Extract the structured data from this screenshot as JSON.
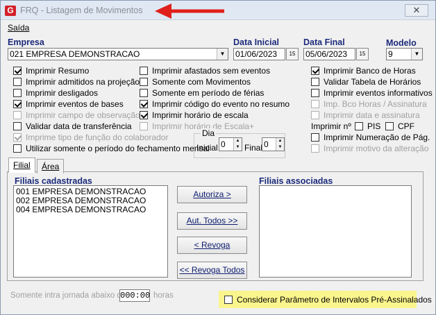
{
  "window": {
    "title": "FRQ - Listagem de Movimentos",
    "close_glyph": "✕",
    "logo_letter": "G"
  },
  "menu": {
    "saida": "Saída"
  },
  "empresa": {
    "label": "Empresa",
    "value": "021 EMPRESA DEMONSTRACAO"
  },
  "data_inicial": {
    "label": "Data Inicial",
    "value": "01/06/2023",
    "button": "15"
  },
  "data_final": {
    "label": "Data Final",
    "value": "05/06/2023",
    "button": "15"
  },
  "modelo": {
    "label": "Modelo",
    "value": "9"
  },
  "checkboxes": {
    "imprimir_resumo": {
      "label": "Imprimir Resumo",
      "checked": true
    },
    "imprimir_admitidos": {
      "label": "Imprimir admitidos na projeção",
      "checked": false
    },
    "imprimir_desligados": {
      "label": "Imprimir desligados",
      "checked": false
    },
    "imprimir_eventos_bases": {
      "label": "Imprimir eventos de bases",
      "checked": true
    },
    "imprimir_campo_obs": {
      "label": "Imprimir campo de observação",
      "checked": false
    },
    "validar_data_transf": {
      "label": "Validar data de transferência",
      "checked": false
    },
    "imprime_tipo_funcao": {
      "label": "Imprime tipo de função do colaborador",
      "checked": true
    },
    "utilizar_periodo_fech": {
      "label": "Utilizar somente o período do fechamento mensal",
      "checked": false
    },
    "imprimir_afastados": {
      "label": "Imprimir afastados sem eventos",
      "checked": false
    },
    "somente_com_mov": {
      "label": "Somente com Movimentos",
      "checked": false
    },
    "somente_ferias": {
      "label": "Somente em período de férias",
      "checked": false
    },
    "imprimir_cod_evento": {
      "label": "Imprimir código do evento no resumo",
      "checked": true
    },
    "imprimir_horario_escala": {
      "label": "Imprimir horário de escala",
      "checked": true
    },
    "imprimir_horario_escala_plus": {
      "label": "Imprimir horário de Escala+",
      "checked": false
    },
    "imprimir_banco_horas": {
      "label": "Imprimir Banco de Horas",
      "checked": true
    },
    "validar_tabela_horarios": {
      "label": "Validar Tabela de Horários",
      "checked": false
    },
    "imprimir_eventos_info": {
      "label": "Imprimir eventos informativos",
      "checked": false
    },
    "imp_bco_horas_assinatura": {
      "label": "Imp. Bco Horas / Assinatura",
      "checked": false
    },
    "imprimir_data_assinatura": {
      "label": "Imprimir data e assinatura",
      "checked": false
    },
    "pis": {
      "label": "PIS",
      "checked": false
    },
    "cpf": {
      "label": "CPF",
      "checked": false
    },
    "imprimir_numeracao": {
      "label": "Imprimir Numeração de Pág.",
      "checked": false
    },
    "imprimir_motivo_alteracao": {
      "label": "Imprimir motivo da alteração",
      "checked": false
    }
  },
  "imprimir_n": "Imprimir nº",
  "dia": {
    "legend": "Dia",
    "inicial_label": "Inicial",
    "inicial_value": "0",
    "final_label": "Final",
    "final_value": "0"
  },
  "tabs": {
    "filial": "Filial",
    "area": "Área"
  },
  "filiais_cadastradas": {
    "label": "Filiais cadastradas",
    "items": [
      "001 EMPRESA DEMONSTRACAO",
      "002 EMPRESA DEMONSTRACAO",
      "004 EMPRESA DEMONSTRACAO"
    ]
  },
  "filiais_associadas": {
    "label": "Filiais associadas"
  },
  "buttons": {
    "autoriza": "Autoriza >",
    "aut_todos": "Aut. Todos >>",
    "revoga": "< Revoga",
    "revoga_todos": "<< Revoga Todos"
  },
  "intrajornada": {
    "label": "Somente intra jornada abaixo de",
    "value": "000:00",
    "unit": "horas"
  },
  "considerar_intervalos": {
    "label": "Considerar Parâmetro de Intervalos Pré-Assinalados",
    "checked": false
  },
  "colors": {
    "highlight": "#fbf58d",
    "label_blue": "#1b2a7a",
    "arrow_red": "#e0201b"
  }
}
